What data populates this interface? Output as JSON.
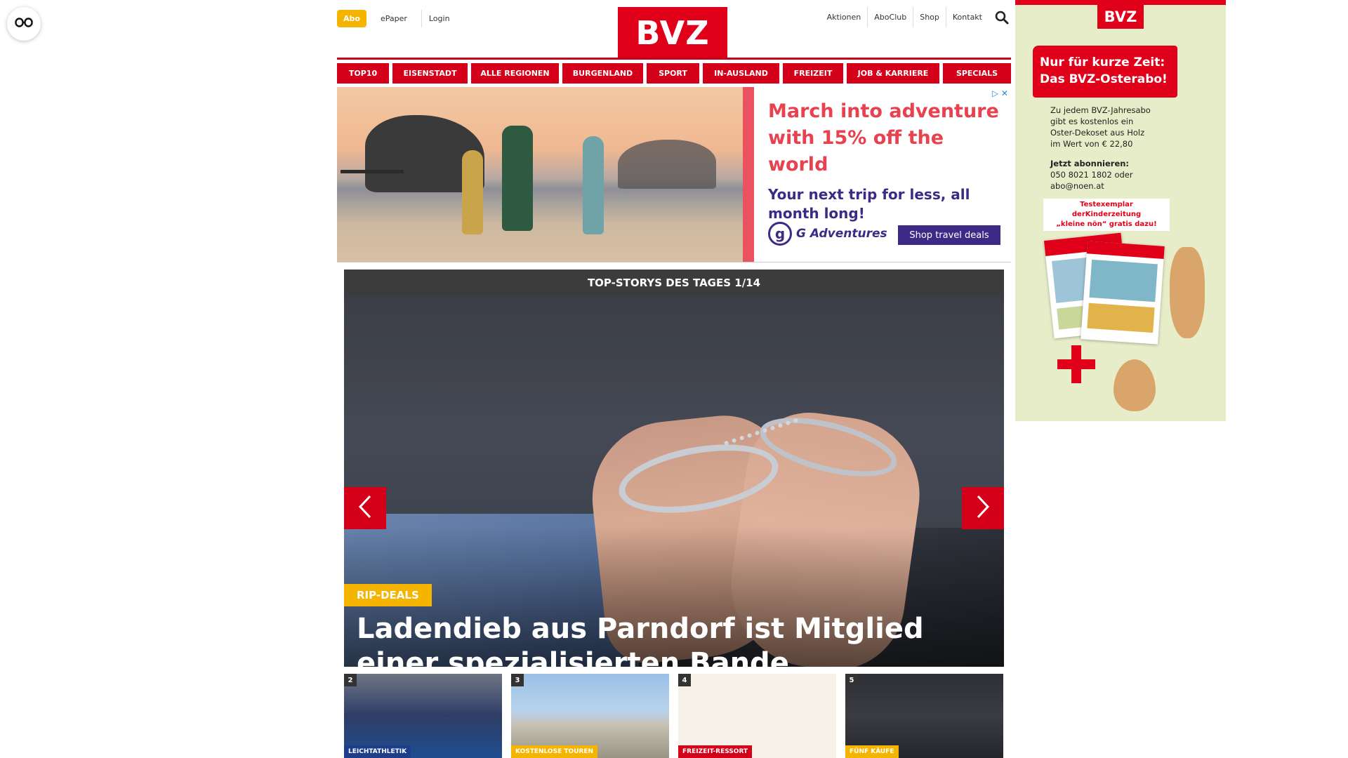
{
  "accessibility": {
    "icon": "accessibility-icon"
  },
  "header": {
    "abo_label": "Abo",
    "left_links": [
      "ePaper",
      "Login"
    ],
    "logo_text": "BVZ",
    "right_links": [
      "Aktionen",
      "AboClub",
      "Shop",
      "Kontakt"
    ],
    "search_icon": "search-icon"
  },
  "categories": [
    "TOP10",
    "EISENSTADT",
    "ALLE REGIONEN",
    "BURGENLAND",
    "SPORT",
    "IN-AUSLAND",
    "FREIZEIT",
    "JOB & KARRIERE",
    "SPECIALS"
  ],
  "ad_banner": {
    "headline": "March into adventure with 15% off the world",
    "subline": "Your next trip for less, all month long!",
    "brand": "G Adventures",
    "cta": "Shop travel deals"
  },
  "slider": {
    "title": "TOP-STORYS DES TAGES 1/14",
    "tag": "RIP-DEALS",
    "headline": "Ladendieb aus Parndorf ist Mitglied einer spezialisierten Bande"
  },
  "thumbs": [
    {
      "num": "2",
      "tag": "LEICHTATHLETIK",
      "tag_color": "#1f3e8a"
    },
    {
      "num": "3",
      "tag": "KOSTENLOSE TOUREN",
      "tag_color": "#f5b400"
    },
    {
      "num": "4",
      "tag": "FREIZEIT-RESSORT",
      "tag_color": "#d4001a"
    },
    {
      "num": "5",
      "tag": "FÜNF KÄUFE",
      "tag_color": "#f5b400"
    }
  ],
  "side_ad": {
    "logo": "BVZ",
    "banner_line1": "Nur für kurze Zeit:",
    "banner_line2": "Das BVZ-Osterabo!",
    "body_line1": "Zu jedem BVZ-Jahresabo",
    "body_line2": "gibt es kostenlos ein",
    "body_line3": "Oster-Dekoset aus Holz",
    "body_line4": "im Wert von € 22,80",
    "subscribe": "Jetzt abonnieren:",
    "phone": "050 8021 1802 oder",
    "email": "abo@noen.at",
    "test_line1": "Testexemplar derKinderzeitung",
    "test_line2": "„kleine nön“ gratis dazu!"
  },
  "colors": {
    "brand_red": "#d4001a",
    "accent_yellow": "#f5b400",
    "ad_purple": "#3d2a87",
    "ad_coral": "#e8414f"
  }
}
